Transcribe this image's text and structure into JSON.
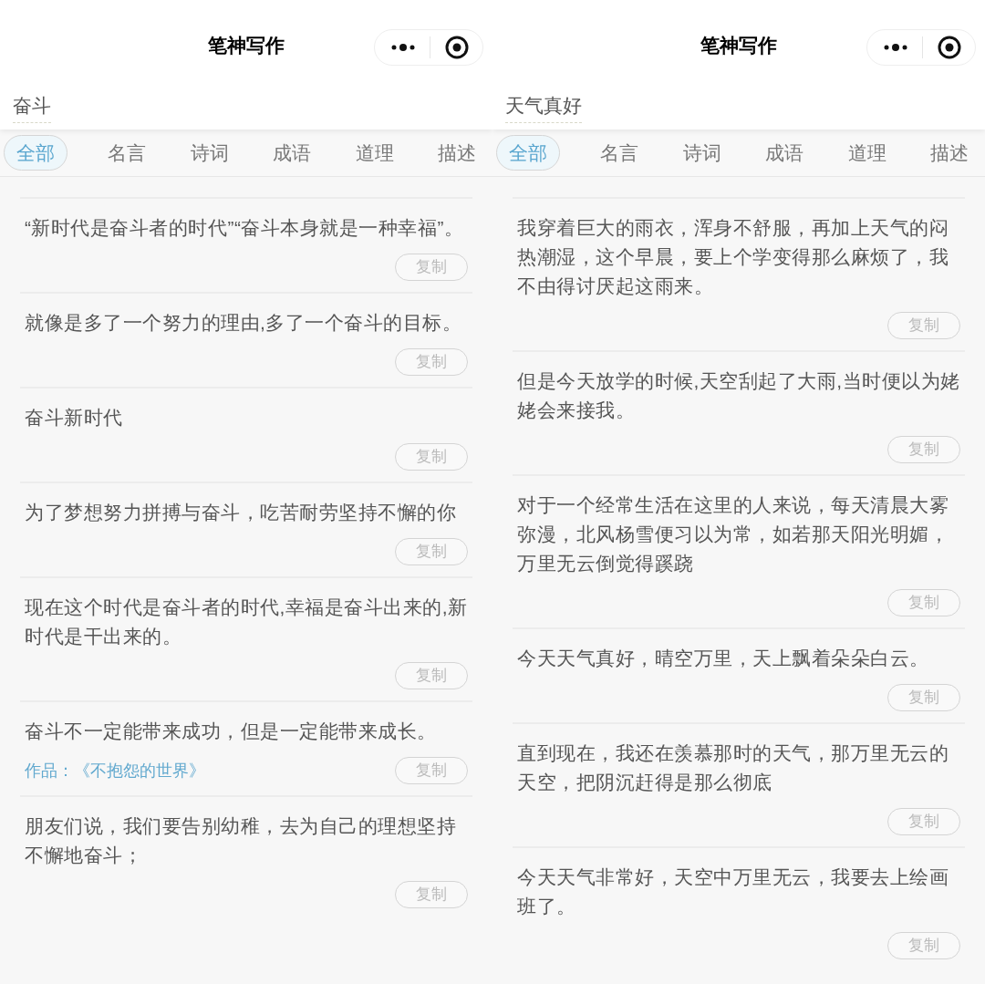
{
  "panels": [
    {
      "title": "笔神写作",
      "search": {
        "value": "奋斗"
      },
      "tabs": [
        {
          "label": "全部",
          "selected": true
        },
        {
          "label": "名言",
          "selected": false
        },
        {
          "label": "诗词",
          "selected": false
        },
        {
          "label": "成语",
          "selected": false
        },
        {
          "label": "道理",
          "selected": false
        },
        {
          "label": "描述",
          "selected": false
        }
      ],
      "items": [
        {
          "text": "“新时代是奋斗者的时代”“奋斗本身就是一种幸福”。",
          "copy": "复制"
        },
        {
          "text": "就像是多了一个努力的理由,多了一个奋斗的目标。",
          "copy": "复制"
        },
        {
          "text": "奋斗新时代",
          "copy": "复制"
        },
        {
          "text": "为了梦想努力拼搏与奋斗，吃苦耐劳坚持不懈的你",
          "copy": "复制"
        },
        {
          "text": "现在这个时代是奋斗者的时代,幸福是奋斗出来的,新时代是干出来的。",
          "copy": "复制"
        },
        {
          "text": "奋斗不一定能带来成功，但是一定能带来成长。",
          "source": "作品：《不抱怨的世界》",
          "copy": "复制"
        },
        {
          "text": "朋友们说，我们要告别幼稚，去为自己的理想坚持不懈地奋斗；",
          "copy": "复制"
        }
      ]
    },
    {
      "title": "笔神写作",
      "search": {
        "value": "天气真好"
      },
      "tabs": [
        {
          "label": "全部",
          "selected": true
        },
        {
          "label": "名言",
          "selected": false
        },
        {
          "label": "诗词",
          "selected": false
        },
        {
          "label": "成语",
          "selected": false
        },
        {
          "label": "道理",
          "selected": false
        },
        {
          "label": "描述",
          "selected": false
        }
      ],
      "items": [
        {
          "text": "我穿着巨大的雨衣，浑身不舒服，再加上天气的闷热潮湿，这个早晨，要上个学变得那么麻烦了，我不由得讨厌起这雨来。",
          "copy": "复制"
        },
        {
          "text": "但是今天放学的时候,天空刮起了大雨,当时便以为姥姥会来接我。",
          "copy": "复制"
        },
        {
          "text": "对于一个经常生活在这里的人来说，每天清晨大雾弥漫，北风杨雪便习以为常，如若那天阳光明媚，万里无云倒觉得蹊跷",
          "copy": "复制"
        },
        {
          "text": "今天天气真好，晴空万里，天上飘着朵朵白云。",
          "copy": "复制"
        },
        {
          "text": "直到现在，我还在羡慕那时的天气，那万里无云的天空，把阴沉赶得是那么彻底",
          "copy": "复制"
        },
        {
          "text": "今天天气非常好，天空中万里无云，我要去上绘画班了。",
          "copy": "复制"
        }
      ]
    }
  ]
}
